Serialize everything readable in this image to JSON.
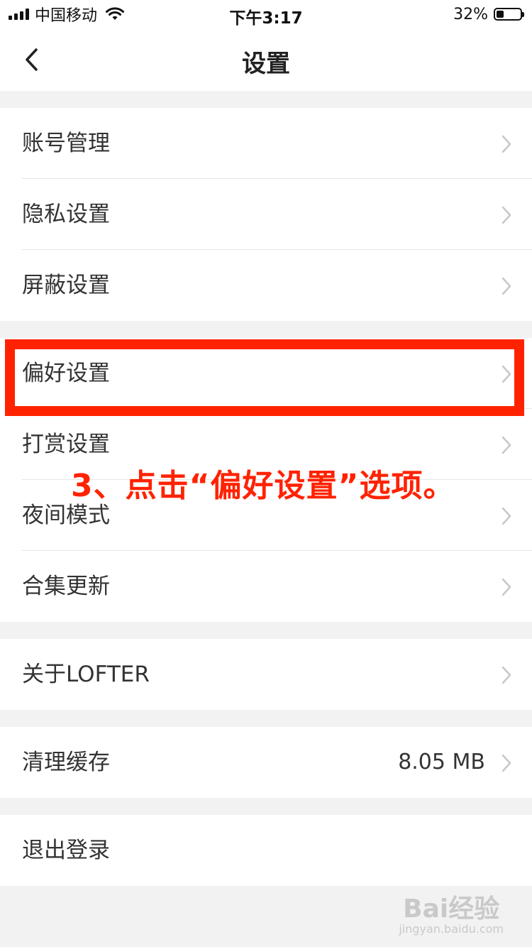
{
  "status_bar": {
    "carrier": "中国移动",
    "time": "下午3:17",
    "battery": "32%",
    "battery_level": 0.32,
    "signal_icon": "signal-bars-icon",
    "wifi_icon": "wifi-icon",
    "battery_icon": "battery-icon"
  },
  "nav": {
    "back_icon": "chevron-left-icon",
    "title": "设置"
  },
  "groups": [
    {
      "items": [
        {
          "label": "账号管理"
        },
        {
          "label": "隐私设置"
        },
        {
          "label": "屏蔽设置"
        }
      ]
    },
    {
      "items": [
        {
          "label": "偏好设置"
        },
        {
          "label": "打赏设置"
        },
        {
          "label": "夜间模式"
        },
        {
          "label": "合集更新"
        }
      ]
    },
    {
      "items": [
        {
          "label": "关于LOFTER"
        }
      ]
    },
    {
      "items": [
        {
          "label": "清理缓存",
          "value": "8.05 MB"
        }
      ]
    },
    {
      "items": [
        {
          "label": "退出登录"
        }
      ]
    }
  ],
  "annotation": {
    "text": "3、点击“偏好设置”选项。",
    "color": "#ff2200"
  },
  "watermark": {
    "logo": "Bai经验",
    "url": "jingyan.baidu.com"
  }
}
